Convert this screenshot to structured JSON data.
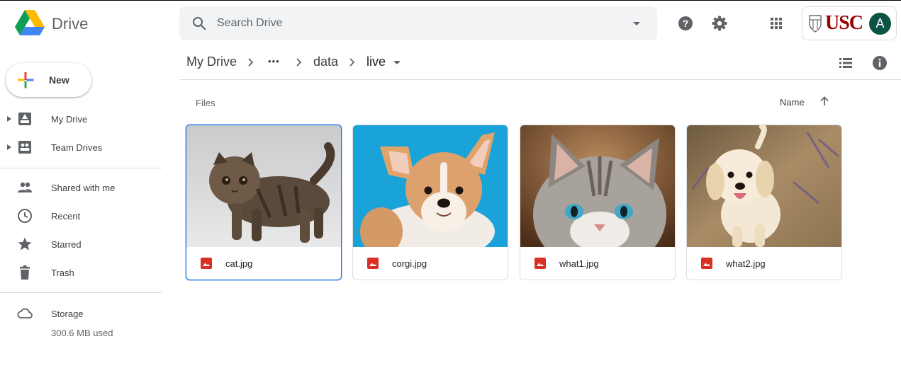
{
  "app": {
    "title": "Drive"
  },
  "search": {
    "placeholder": "Search Drive"
  },
  "account": {
    "org": "USC",
    "avatar_initial": "A"
  },
  "sidebar": {
    "new_label": "New",
    "items": [
      {
        "label": "My Drive",
        "icon": "my-drive-icon"
      },
      {
        "label": "Team Drives",
        "icon": "team-drives-icon"
      },
      {
        "label": "Shared with me",
        "icon": "people-icon"
      },
      {
        "label": "Recent",
        "icon": "clock-icon"
      },
      {
        "label": "Starred",
        "icon": "star-icon"
      },
      {
        "label": "Trash",
        "icon": "trash-icon"
      }
    ],
    "storage": {
      "label": "Storage",
      "used": "300.6 MB used"
    }
  },
  "breadcrumb": {
    "root": "My Drive",
    "ellipsis": "•••",
    "parent": "data",
    "current": "live"
  },
  "content": {
    "section_label": "Files",
    "sort_label": "Name",
    "files": [
      {
        "name": "cat.jpg",
        "selected": true
      },
      {
        "name": "corgi.jpg",
        "selected": false
      },
      {
        "name": "what1.jpg",
        "selected": false
      },
      {
        "name": "what2.jpg",
        "selected": false
      }
    ]
  },
  "colors": {
    "accent": "#1a73e8",
    "usc_red": "#990000",
    "avatar_bg": "#0b5345",
    "image_file_icon": "#d93025"
  }
}
